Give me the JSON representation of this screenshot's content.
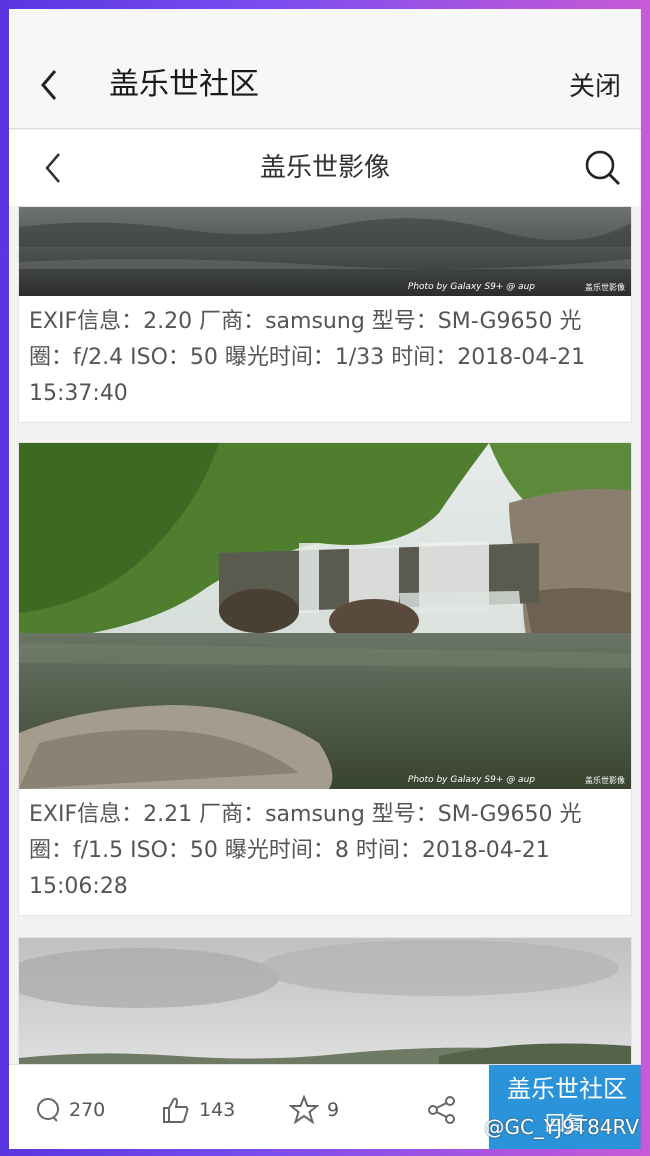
{
  "appbar": {
    "title": "盖乐世社区",
    "close_label": "关闭"
  },
  "navbar": {
    "title": "盖乐世影像"
  },
  "cards": [
    {
      "caption": "EXIF信息：2.20 厂商：samsung 型号：SM-G9650 光圈：f/2.4 ISO：50 曝光时间：1/33 时间：2018-04-21 15:37:40",
      "watermark": "Photo by Galaxy S9+ @ aup",
      "brand_mark": "盖乐世影像"
    },
    {
      "caption": "EXIF信息：2.21 厂商：samsung 型号：SM-G9650 光圈：f/1.5 ISO：50 曝光时间：8 时间：2018-04-21 15:06:28",
      "watermark": "Photo by Galaxy S9+ @ aup",
      "brand_mark": "盖乐世影像"
    }
  ],
  "bottombar": {
    "comments": "270",
    "likes": "143",
    "favorites": "9",
    "reply_logo": "盖乐世社区",
    "reply_label": "回复",
    "user_tag": "@GC_YJ9T84RV"
  },
  "colors": {
    "reply_bg": "#2a93d9",
    "frame_border": "#6a40e6"
  }
}
